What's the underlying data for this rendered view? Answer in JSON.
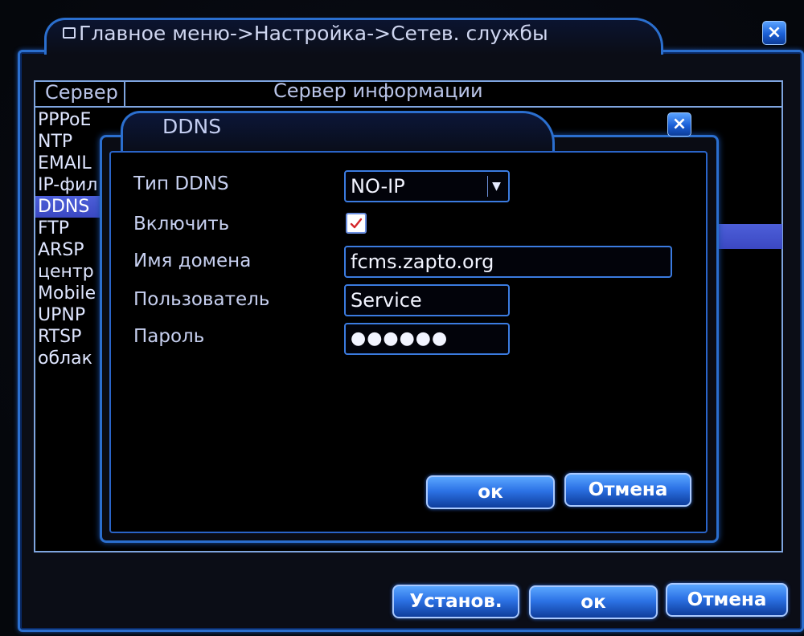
{
  "main_window": {
    "title": "Главное меню->Настройка->Сетев. службы",
    "title_icon": "window-icon",
    "close_label": "×"
  },
  "server_panel": {
    "header_server": "Сервер",
    "header_info": "Сервер информации",
    "items": [
      {
        "label": "PPPoE",
        "selected": false
      },
      {
        "label": "NTP",
        "selected": false
      },
      {
        "label": "EMAIL",
        "selected": false
      },
      {
        "label": "IP-фил",
        "selected": false
      },
      {
        "label": "DDNS",
        "selected": true
      },
      {
        "label": "FTP",
        "selected": false
      },
      {
        "label": "ARSP",
        "selected": false
      },
      {
        "label": "центр",
        "selected": false
      },
      {
        "label": "Mobile",
        "selected": false
      },
      {
        "label": "UPNP",
        "selected": false
      },
      {
        "label": "RTSP",
        "selected": false
      },
      {
        "label": "облак",
        "selected": false
      }
    ]
  },
  "ddns_dialog": {
    "title": "DDNS",
    "close_label": "×",
    "labels": {
      "type": "Тип DDNS",
      "enable": "Включить",
      "domain": "Имя домена",
      "user": "Пользователь",
      "password": "Пароль"
    },
    "values": {
      "type": "NO-IP",
      "enabled": true,
      "domain": "fcms.zapto.org",
      "user": "Service",
      "password": "●●●●●●"
    },
    "buttons": {
      "ok": "ок",
      "cancel": "Отмена"
    }
  },
  "footer_buttons": {
    "set": "Установ.",
    "ok": "ок",
    "cancel": "Отмена"
  },
  "colors": {
    "accent": "#2b6fcf",
    "selection": "#4d5fd9",
    "checkmark": "#d4262a"
  }
}
